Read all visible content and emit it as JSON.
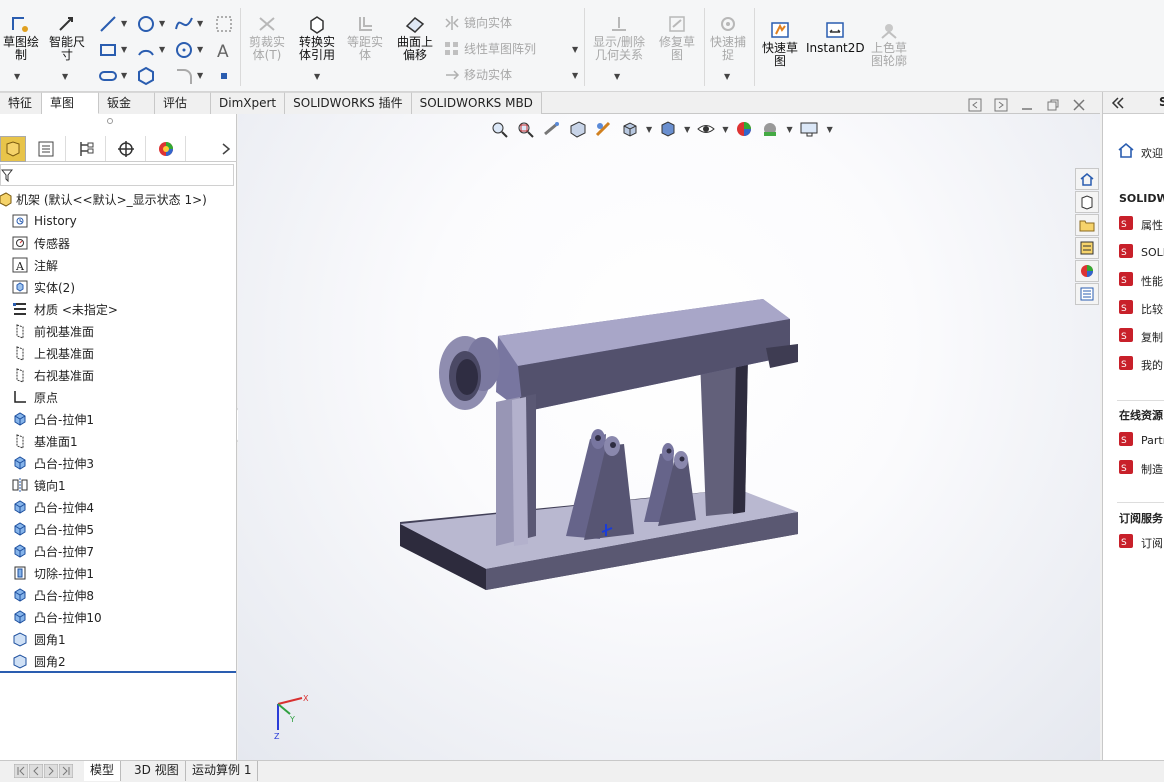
{
  "ribbon": {
    "sketch_draw": "草图绘\n制",
    "smart_dim": "智能尺\n寸",
    "trim": "剪裁实\n体(T)",
    "convert": "转换实\n体引用",
    "offset": "等距实\n体",
    "surface_offset": "曲面上\n偏移",
    "mirror": "镜向实体",
    "linear_pattern": "线性草图阵列",
    "move": "移动实体",
    "show_delete": "显示/删除\n几何关系",
    "repair": "修复草\n图",
    "quick_snap": "快速捕\n捉",
    "rapid_sketch": "快速草\n图",
    "instant2d": "Instant2D",
    "shaded_contours": "上色草\n图轮廓"
  },
  "tabs": [
    "特征",
    "草图",
    "钣金",
    "评估",
    "DimXpert",
    "SOLIDWORKS 插件",
    "SOLIDWORKS MBD"
  ],
  "tree": {
    "root": "机架  (默认<<默认>_显示状态 1>)",
    "items": [
      {
        "label": "History",
        "icon": "history-icon"
      },
      {
        "label": "传感器",
        "icon": "sensor-icon"
      },
      {
        "label": "注解",
        "icon": "annotation-icon"
      },
      {
        "label": "实体(2)",
        "icon": "solid-bodies-icon"
      },
      {
        "label": "材质 <未指定>",
        "icon": "material-icon"
      },
      {
        "label": "前视基准面",
        "icon": "plane-icon"
      },
      {
        "label": "上视基准面",
        "icon": "plane-icon"
      },
      {
        "label": "右视基准面",
        "icon": "plane-icon"
      },
      {
        "label": "原点",
        "icon": "origin-icon"
      },
      {
        "label": "凸台-拉伸1",
        "icon": "extrude-icon"
      },
      {
        "label": "基准面1",
        "icon": "plane-icon"
      },
      {
        "label": "凸台-拉伸3",
        "icon": "extrude-icon"
      },
      {
        "label": "镜向1",
        "icon": "mirror-icon"
      },
      {
        "label": "凸台-拉伸4",
        "icon": "extrude-icon"
      },
      {
        "label": "凸台-拉伸5",
        "icon": "extrude-icon"
      },
      {
        "label": "凸台-拉伸7",
        "icon": "extrude-icon"
      },
      {
        "label": "切除-拉伸1",
        "icon": "cut-icon"
      },
      {
        "label": "凸台-拉伸8",
        "icon": "extrude-icon"
      },
      {
        "label": "凸台-拉伸10",
        "icon": "extrude-icon"
      },
      {
        "label": "圆角1",
        "icon": "fillet-icon"
      },
      {
        "label": "圆角2",
        "icon": "fillet-icon"
      }
    ]
  },
  "bottom_tabs": [
    "模型",
    "3D 视图",
    "运动算例 1"
  ],
  "taskpane": {
    "welcome": "欢迎",
    "section1": "SOLIDWO",
    "items1": [
      "属性",
      "SOLI",
      "性能",
      "比较",
      "复制",
      "我的"
    ],
    "section2": "在线资源",
    "items2": [
      "Partn",
      "制造"
    ],
    "section3": "订阅服务",
    "items3": [
      "订阅"
    ],
    "title": "S"
  },
  "triad": {
    "x": "X",
    "y": "Y",
    "z": "Z"
  }
}
